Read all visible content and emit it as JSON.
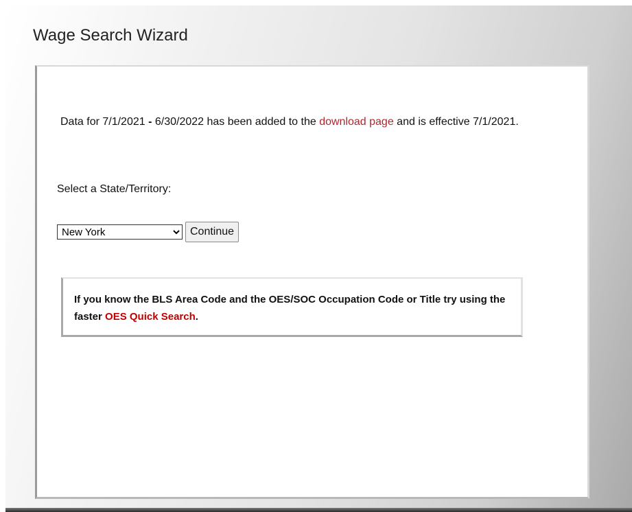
{
  "page": {
    "title": "Wage Search Wizard"
  },
  "notice": {
    "prefix": "Data for 7/1/2021 ",
    "dash": "-",
    "middle": " 6/30/2022 has been added to the ",
    "link_text": "download page",
    "suffix": " and is effective 7/1/2021."
  },
  "state_selector": {
    "label": "Select a State/Territory:",
    "selected_value": "New York",
    "continue_label": "Continue"
  },
  "quick_search": {
    "text": "If you know the BLS Area Code and the OES/SOC Occupation Code or Title try using the faster ",
    "link_text": "OES Quick Search",
    "end": "."
  },
  "colors": {
    "link": "#b0262c",
    "quick_link": "#c00000"
  }
}
